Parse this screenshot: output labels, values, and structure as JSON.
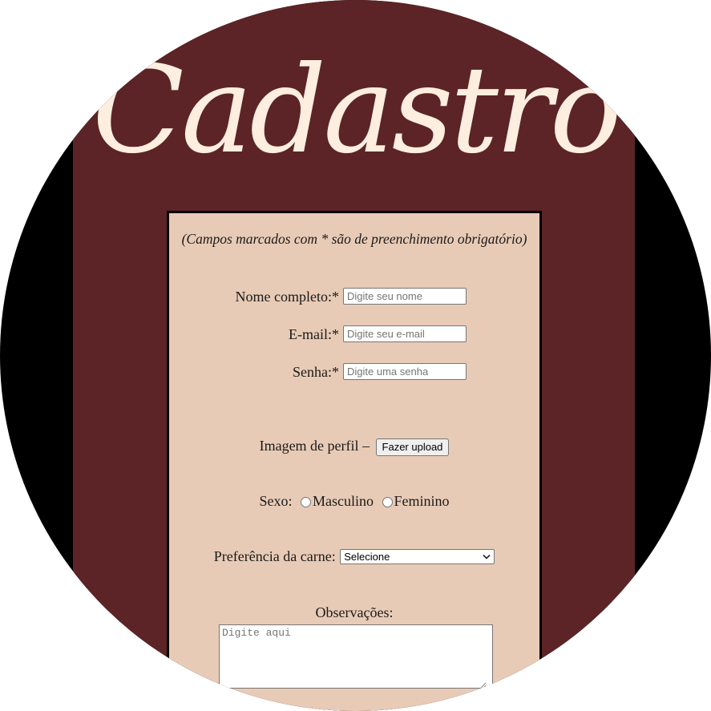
{
  "page": {
    "title": "Cadastro"
  },
  "form": {
    "required_note": "(Campos marcados com * são de preenchimento obrigatório)",
    "name": {
      "label": "Nome completo:*",
      "placeholder": "Digite seu nome",
      "value": ""
    },
    "email": {
      "label": "E-mail:*",
      "placeholder": "Digite seu e-mail",
      "value": ""
    },
    "password": {
      "label": "Senha:*",
      "placeholder": "Digite uma senha",
      "value": ""
    },
    "profile_image": {
      "label": "Imagem de perfil –",
      "button_label": "Fazer upload"
    },
    "sex": {
      "label": "Sexo:",
      "options": [
        "Masculino",
        "Feminino"
      ]
    },
    "meat_preference": {
      "label": "Preferência da carne:",
      "selected": "Selecione"
    },
    "observations": {
      "label": "Observações:",
      "placeholder": "Digite aqui",
      "value": ""
    }
  },
  "colors": {
    "outer_background": "#000000",
    "column_background": "#5c2426",
    "card_background": "#e8cbb6",
    "title_color": "#fdeee0"
  },
  "icons": {
    "select_arrow": "chevron-down-icon",
    "textarea_grip": "resize-grip-icon"
  }
}
